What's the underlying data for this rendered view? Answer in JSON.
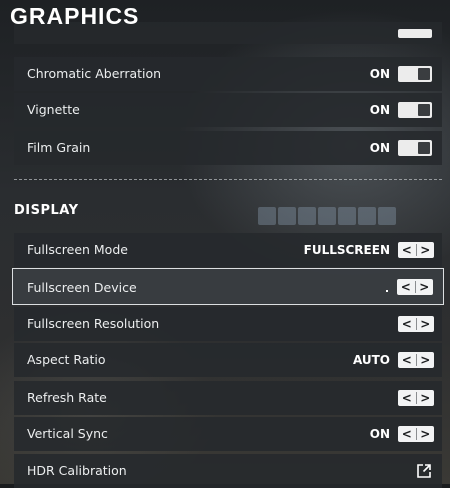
{
  "header": {
    "title": "GRAPHICS"
  },
  "effects": [
    {
      "label": "Chromatic Aberration",
      "value": "ON"
    },
    {
      "label": "Vignette",
      "value": "ON"
    },
    {
      "label": "Film Grain",
      "value": "ON"
    }
  ],
  "display": {
    "section_title": "DISPLAY",
    "rows": [
      {
        "label": "Fullscreen Mode",
        "value": "FULLSCREEN"
      },
      {
        "label": "Fullscreen Device",
        "value": ""
      },
      {
        "label": "Fullscreen Resolution",
        "value": ""
      },
      {
        "label": "Aspect Ratio",
        "value": "AUTO"
      },
      {
        "label": "Refresh Rate",
        "value": ""
      },
      {
        "label": "Vertical Sync",
        "value": "ON"
      },
      {
        "label": "HDR Calibration",
        "icon": "external-link-icon"
      }
    ]
  },
  "stepper": {
    "prev": "<",
    "next": ">"
  },
  "colors": {
    "toggle_on": "#ececec",
    "row_bg": "#26292c",
    "selected_border": "#dcdfe1"
  }
}
